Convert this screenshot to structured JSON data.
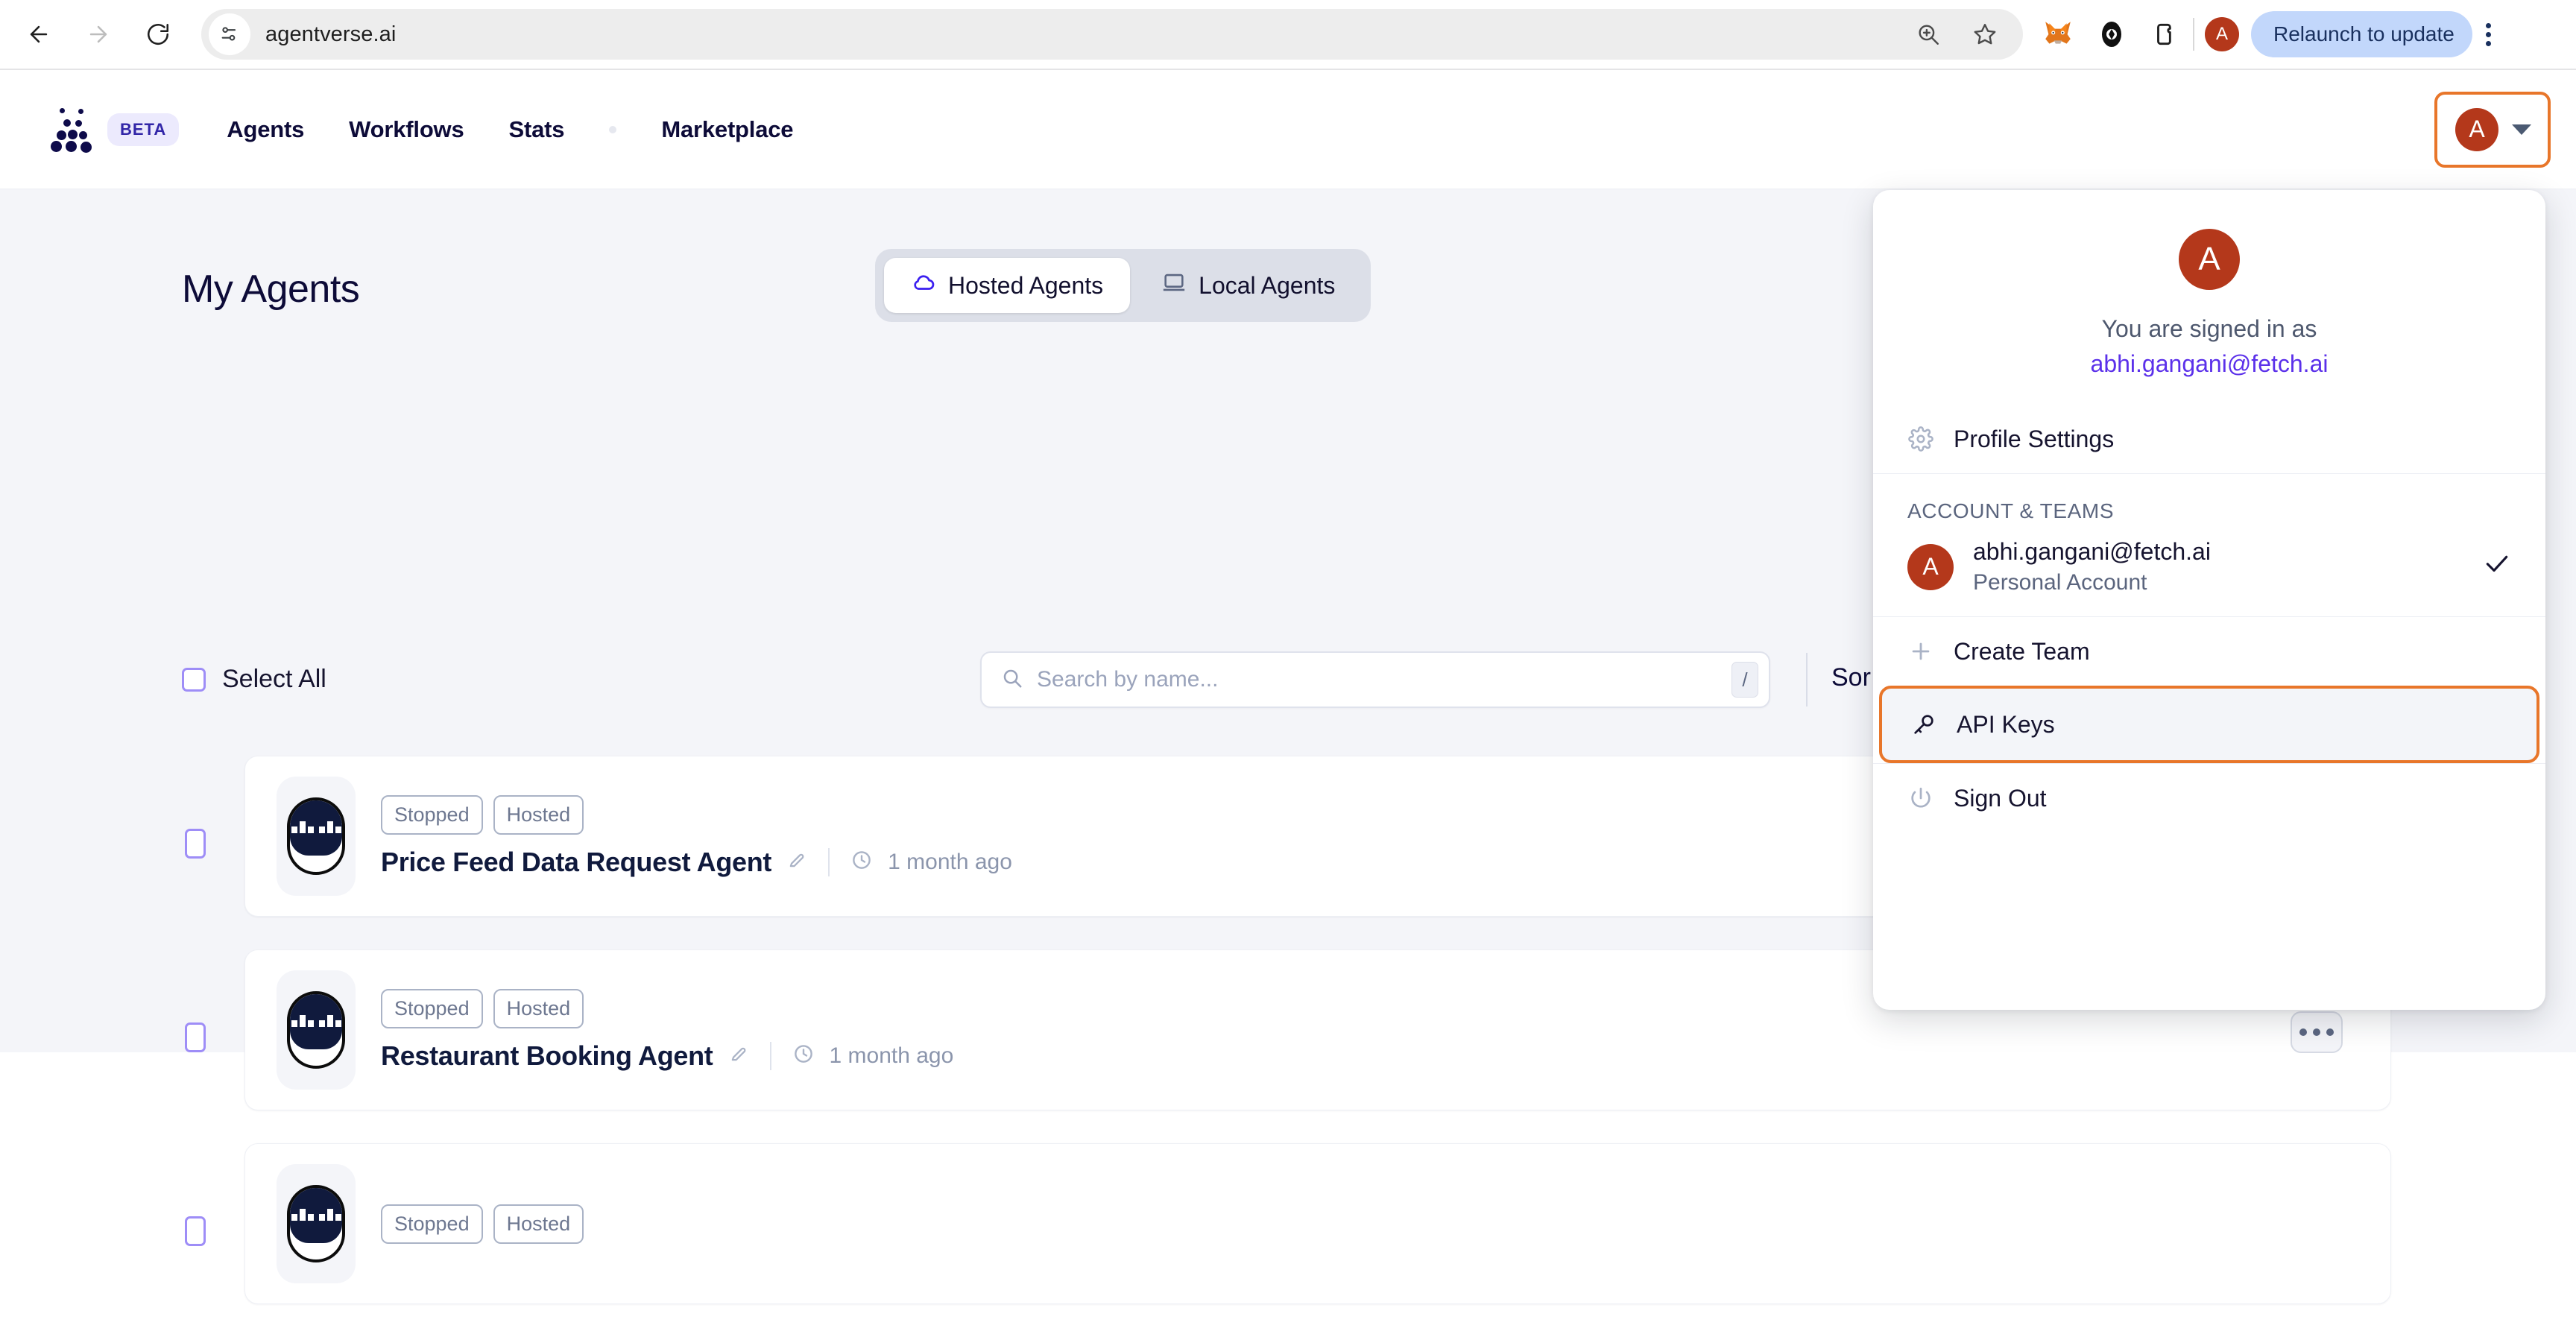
{
  "browser": {
    "back_icon": "arrow-left-icon",
    "forward_icon": "arrow-right-icon",
    "reload_icon": "reload-icon",
    "site_info_icon": "site-settings-icon",
    "url": "agentverse.ai",
    "zoom_icon": "zoom-in-icon",
    "bookmark_icon": "star-icon",
    "extensions": [
      "metamask-fox-icon",
      "extension-eye-icon",
      "extension-puzzle-icon"
    ],
    "profile_initial": "A",
    "relaunch_label": "Relaunch to update",
    "menu_icon": "kebab-menu-icon"
  },
  "app_header": {
    "logo_name": "agentverse-logo",
    "beta_badge": "BETA",
    "nav": [
      {
        "label": "Agents"
      },
      {
        "label": "Workflows"
      },
      {
        "label": "Stats"
      },
      {
        "label": "Marketplace"
      }
    ],
    "avatar_initial": "A",
    "caret_icon": "chevron-down-icon"
  },
  "main": {
    "page_title": "My Agents",
    "tabs": [
      {
        "label": "Hosted Agents",
        "icon": "cloud-icon",
        "active": true
      },
      {
        "label": "Local Agents",
        "icon": "laptop-icon",
        "active": false
      }
    ],
    "select_all_label": "Select All",
    "search": {
      "placeholder": "Search by name...",
      "icon": "search-icon",
      "shortcut_key": "/"
    },
    "sort_label": "Sor",
    "agents": [
      {
        "status": "Stopped",
        "type": "Hosted",
        "name": "Price Feed Data Request Agent",
        "edit_icon": "edit-pencil-icon",
        "clock_icon": "clock-icon",
        "updated": "1 month ago"
      },
      {
        "status": "Stopped",
        "type": "Hosted",
        "name": "Restaurant Booking Agent",
        "edit_icon": "edit-pencil-icon",
        "clock_icon": "clock-icon",
        "updated": "1 month ago"
      },
      {
        "status": "Stopped",
        "type": "Hosted",
        "name": "",
        "edit_icon": "edit-pencil-icon",
        "clock_icon": "clock-icon",
        "updated": ""
      }
    ],
    "more_button_icon": "ellipsis-icon"
  },
  "dropdown": {
    "avatar_initial": "A",
    "signed_in_text": "You are signed in as",
    "email": "abhi.gangani@fetch.ai",
    "profile_settings": {
      "label": "Profile Settings",
      "icon": "gear-icon"
    },
    "section_label": "ACCOUNT & TEAMS",
    "account": {
      "initial": "A",
      "email": "abhi.gangani@fetch.ai",
      "subtitle": "Personal Account",
      "check_icon": "check-icon"
    },
    "create_team": {
      "label": "Create Team",
      "icon": "plus-icon"
    },
    "api_keys": {
      "label": "API Keys",
      "icon": "key-icon"
    },
    "sign_out": {
      "label": "Sign Out",
      "icon": "power-icon"
    }
  },
  "colors": {
    "accent_orange": "#e8762a",
    "avatar_red": "#b4381b",
    "brand_navy": "#0d0b38",
    "link_purple": "#5b30ea",
    "page_bg": "#f4f5f9"
  }
}
